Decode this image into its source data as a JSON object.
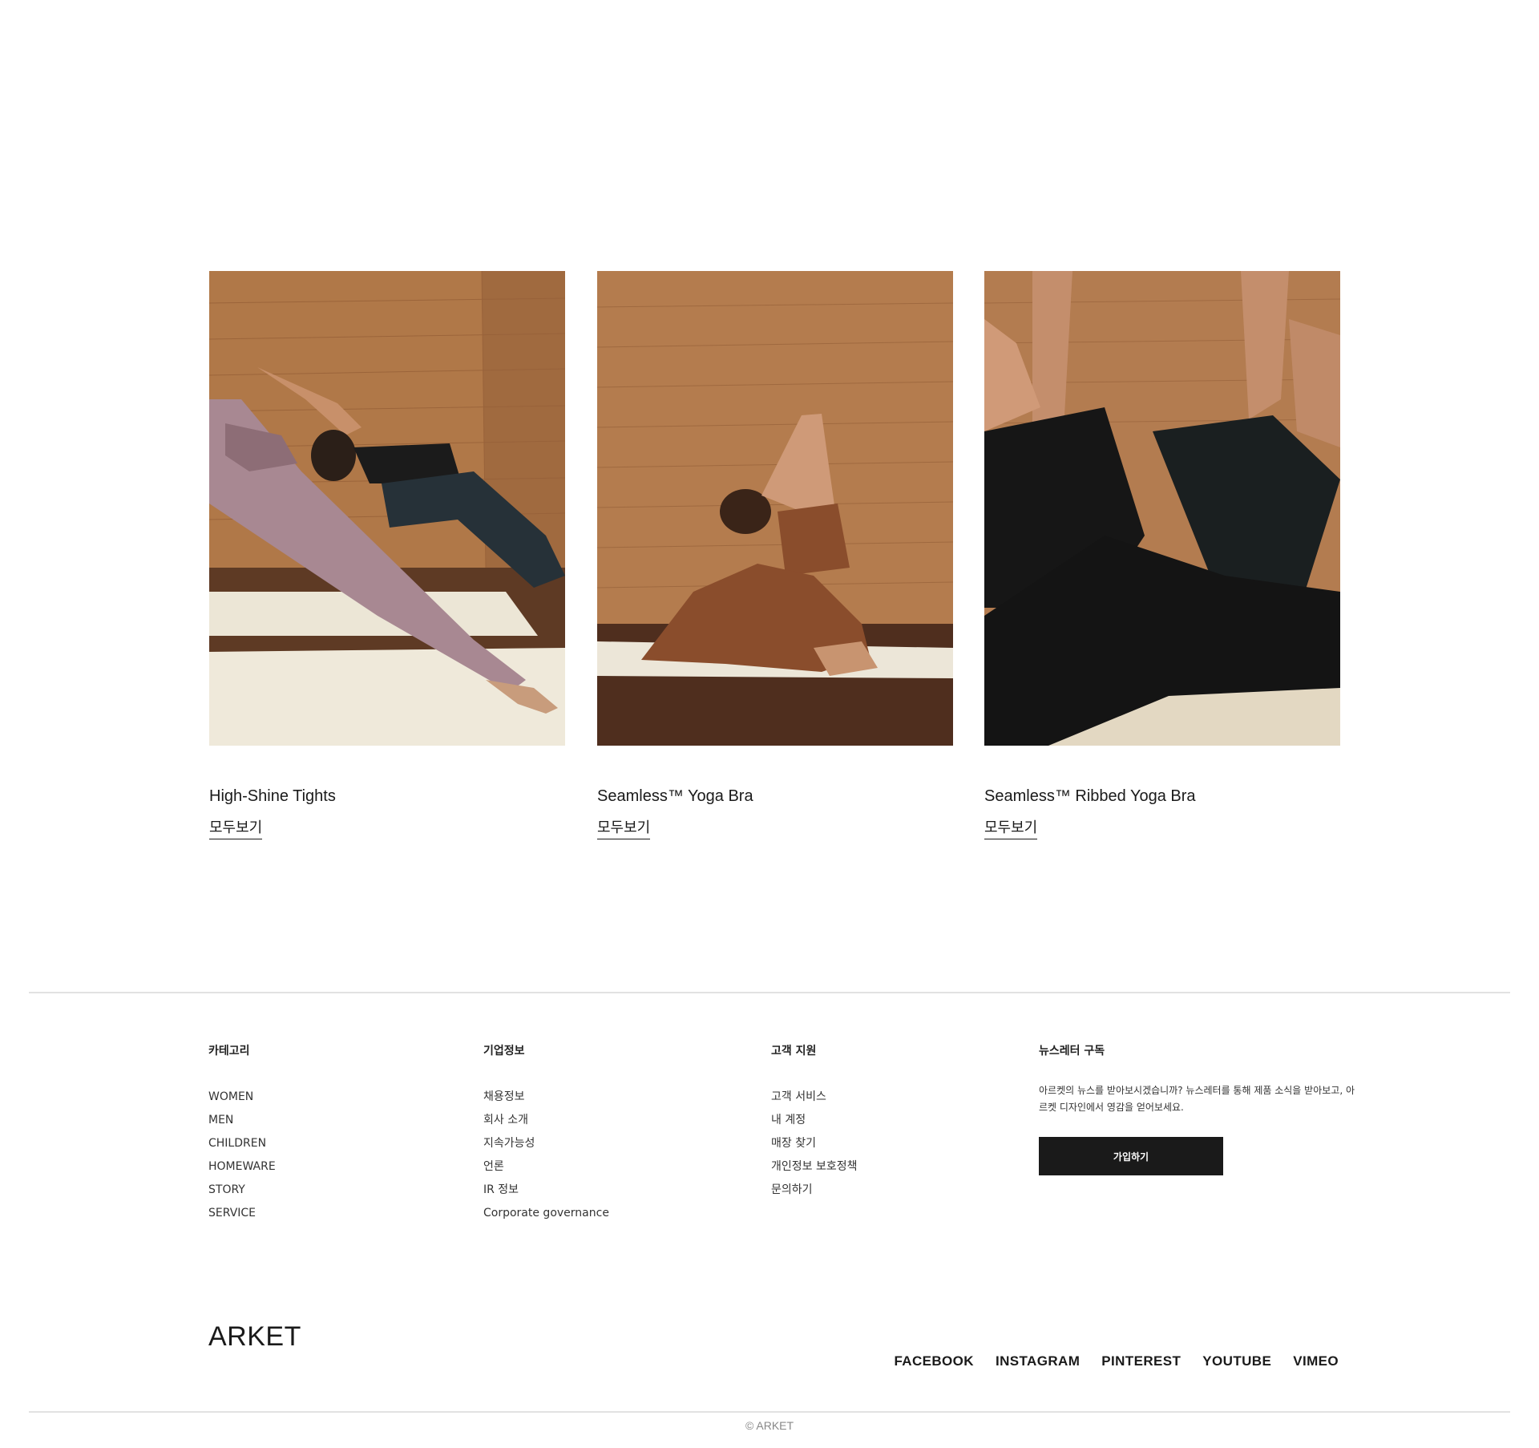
{
  "products": [
    {
      "title": "High-Shine Tights",
      "link": "모두보기"
    },
    {
      "title": "Seamless™ Yoga Bra",
      "link": "모두보기"
    },
    {
      "title": "Seamless™ Ribbed Yoga Bra",
      "link": "모두보기"
    }
  ],
  "footer": {
    "categories": {
      "title": "카테고리",
      "items": [
        "WOMEN",
        "MEN",
        "CHILDREN",
        "HOMEWARE",
        "STORY",
        "SERVICE"
      ]
    },
    "company": {
      "title": "기업정보",
      "items": [
        "채용정보",
        "회사 소개",
        "지속가능성",
        "언론",
        "IR 정보",
        "Corporate governance"
      ]
    },
    "support": {
      "title": "고객 지원",
      "items": [
        "고객 서비스",
        "내 계정",
        "매장 찾기",
        "개인정보 보호정책",
        "문의하기"
      ]
    },
    "newsletter": {
      "title": "뉴스레터 구독",
      "text": "아르켓의 뉴스를 받아보시겠습니까? 뉴스레터를 통해 제품 소식을 받아보고, 아르켓 디자인에서 영감을 얻어보세요.",
      "button": "가입하기"
    }
  },
  "brand": "ARKET",
  "social": [
    "FACEBOOK",
    "INSTAGRAM",
    "PINTEREST",
    "YOUTUBE",
    "VIMEO"
  ],
  "copyright": "© ARKET",
  "colors": {
    "text": "#1a1a1a",
    "button_bg": "#1a1a1a",
    "rule": "#e2e2e2",
    "muted": "#888888"
  }
}
